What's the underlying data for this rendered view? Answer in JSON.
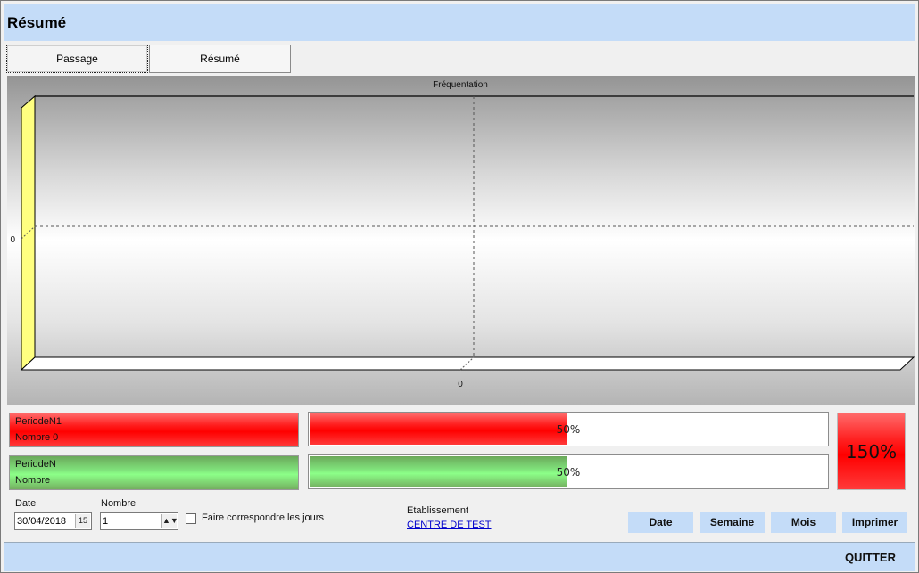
{
  "window": {
    "title": "Résumé"
  },
  "tabs": [
    {
      "label": "Passage"
    },
    {
      "label": "Résumé"
    }
  ],
  "chart_data": {
    "type": "bar",
    "title": "Fréquentation",
    "categories": [
      "0"
    ],
    "series": [],
    "y_tick_labels": [
      "0"
    ],
    "x_tick_labels": [
      "0"
    ],
    "grid": true,
    "legend": "none",
    "wall_color": "#ffff80"
  },
  "periods": [
    {
      "name": "PeriodeN1",
      "count_label": "Nombre 0",
      "percent": 50,
      "percent_label": "50%",
      "color": "#ff0000"
    },
    {
      "name": "PeriodeN",
      "count_label": "Nombre",
      "percent": 50,
      "percent_label": "50%",
      "color": "#80ff80"
    }
  ],
  "ratio": {
    "label": "150%",
    "color": "#ff0000"
  },
  "filters": {
    "date_label": "Date",
    "date_value": "30/04/2018",
    "nombre_label": "Nombre",
    "nombre_value": "1",
    "match_days_label": "Faire correspondre les jours",
    "match_days_checked": false,
    "etablissement_label": "Etablissement",
    "etablissement_value": "CENTRE DE TEST"
  },
  "buttons": {
    "date": "Date",
    "semaine": "Semaine",
    "mois": "Mois",
    "imprimer": "Imprimer"
  },
  "footer": {
    "quit": "QUITTER"
  }
}
